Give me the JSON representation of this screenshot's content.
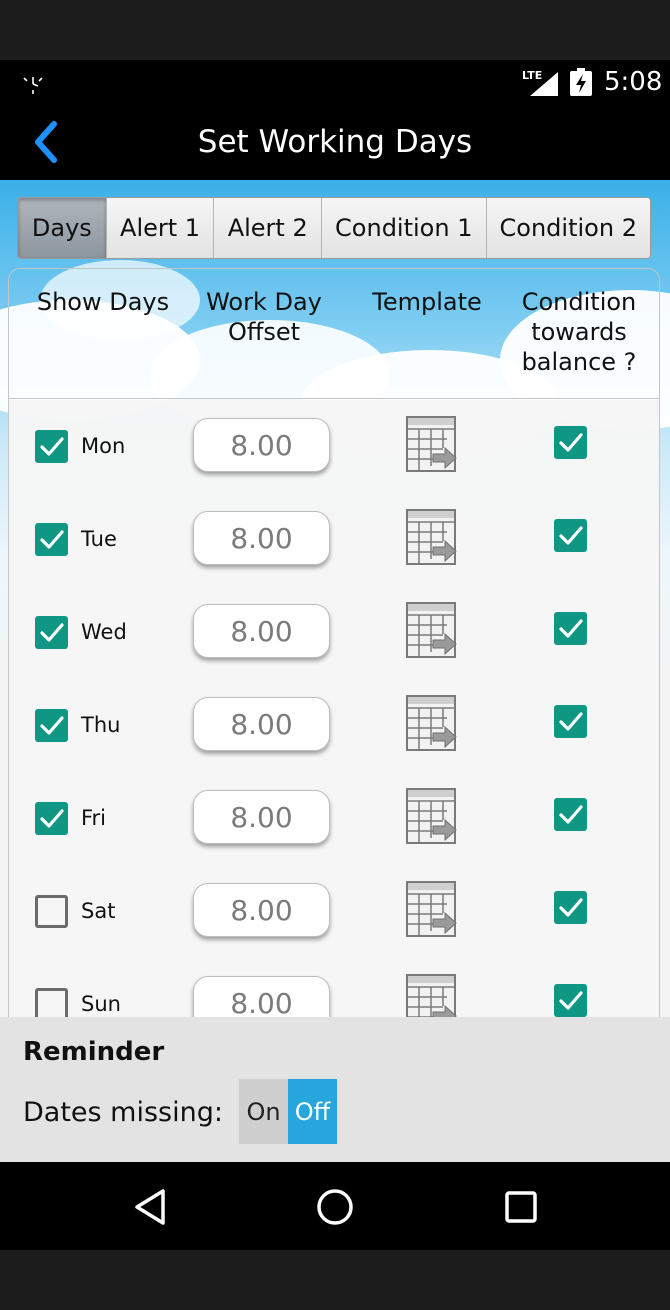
{
  "status_bar": {
    "network": "LTE",
    "time": "5:08",
    "icons": [
      "alarm-icon",
      "signal-icon",
      "battery-charging-icon"
    ]
  },
  "app_bar": {
    "back_icon": "chevron-left-icon",
    "title": "Set Working Days"
  },
  "tabs": [
    {
      "label": "Days",
      "active": true
    },
    {
      "label": "Alert 1",
      "active": false
    },
    {
      "label": "Alert 2",
      "active": false
    },
    {
      "label": "Condition 1",
      "active": false
    },
    {
      "label": "Condition 2",
      "active": false
    }
  ],
  "columns": {
    "show_days": "Show Days",
    "offset_line1": "Work Day",
    "offset_line2": "Offset",
    "template": "Template",
    "cond_line1": "Condition",
    "cond_line2": "towards",
    "cond_line3": "balance ?"
  },
  "days": [
    {
      "label": "Mon",
      "shown": true,
      "offset": "8.00",
      "condition": true
    },
    {
      "label": "Tue",
      "shown": true,
      "offset": "8.00",
      "condition": true
    },
    {
      "label": "Wed",
      "shown": true,
      "offset": "8.00",
      "condition": true
    },
    {
      "label": "Thu",
      "shown": true,
      "offset": "8.00",
      "condition": true
    },
    {
      "label": "Fri",
      "shown": true,
      "offset": "8.00",
      "condition": true
    },
    {
      "label": "Sat",
      "shown": false,
      "offset": "8.00",
      "condition": true
    },
    {
      "label": "Sun",
      "shown": false,
      "offset": "8.00",
      "condition": true
    }
  ],
  "reminder": {
    "title": "Reminder",
    "label": "Dates missing:",
    "on_label": "On",
    "off_label": "Off",
    "value": "Off"
  },
  "nav_bar": {
    "icons": [
      "back-triangle-icon",
      "home-circle-icon",
      "recents-square-icon"
    ]
  },
  "colors": {
    "accent_teal": "#0f9784",
    "toggle_blue": "#27a6de",
    "back_arrow_blue": "#1e90ff"
  }
}
